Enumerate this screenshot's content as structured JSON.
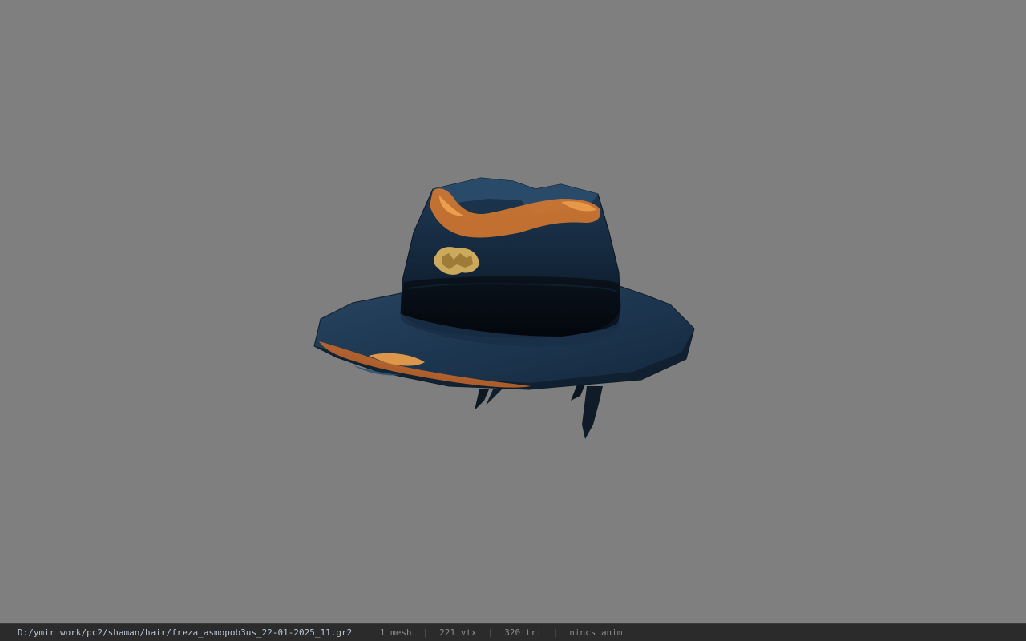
{
  "viewer": {
    "background_color": "#7f7f7f",
    "model_name": "hat-model"
  },
  "status": {
    "path": "D:/ymir work/pc2/shaman/hair/freza_asmopob3us_22-01-2025_11.gr2",
    "meshes": "1 mesh",
    "vertices": "221 vtx",
    "triangles": "320 tri",
    "anim": "nincs anim",
    "separator": "|"
  }
}
